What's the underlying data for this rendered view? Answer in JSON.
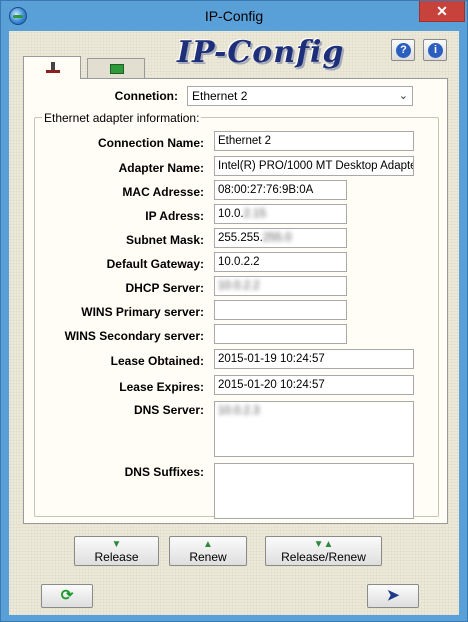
{
  "window": {
    "title": "IP-Config",
    "close_symbol": "✕",
    "app_icon": "globe-network-icon"
  },
  "banner": {
    "text": "IP-Config",
    "help_symbol": "?",
    "info_symbol": "i"
  },
  "tabs": [
    {
      "name": "ethernet",
      "icon": "ethernet-plug-icon",
      "active": true
    },
    {
      "name": "network",
      "icon": "network-card-icon",
      "active": false
    }
  ],
  "connection": {
    "label": "Connetion:",
    "selected": "Ethernet 2"
  },
  "group": {
    "title": "Ethernet adapter information:"
  },
  "fields": {
    "connection_name": {
      "label": "Connection Name:",
      "value": "Ethernet 2"
    },
    "adapter_name": {
      "label": "Adapter Name:",
      "value": "Intel(R) PRO/1000 MT Desktop Adapter"
    },
    "mac": {
      "label": "MAC Adresse:",
      "value": "08:00:27:76:9B:0A"
    },
    "ip": {
      "label": "IP Adress:",
      "value": "10.0.",
      "blurred": "2.15"
    },
    "subnet": {
      "label": "Subnet Mask:",
      "value": "255.255.",
      "blurred": "255.0"
    },
    "gateway": {
      "label": "Default Gateway:",
      "value": "10.0.2.2"
    },
    "dhcp": {
      "label": "DHCP Server:",
      "value": "",
      "blurred": "10.0.2.2"
    },
    "wins_primary": {
      "label": "WINS Primary server:",
      "value": ""
    },
    "wins_secondary": {
      "label": "WINS Secondary server:",
      "value": ""
    },
    "lease_obtained": {
      "label": "Lease Obtained:",
      "value": "2015-01-19 10:24:57"
    },
    "lease_expires": {
      "label": "Lease Expires:",
      "value": "2015-01-20 10:24:57"
    },
    "dns_server": {
      "label": "DNS Server:",
      "value": "",
      "blurred": "10.0.2.3"
    },
    "dns_suffixes": {
      "label": "DNS Suffixes:",
      "value": ""
    }
  },
  "buttons": {
    "release": "Release",
    "renew": "Renew",
    "release_renew": "Release/Renew"
  },
  "footer": {
    "refresh_icon": "refresh-icon",
    "exit_icon": "exit-door-icon"
  }
}
